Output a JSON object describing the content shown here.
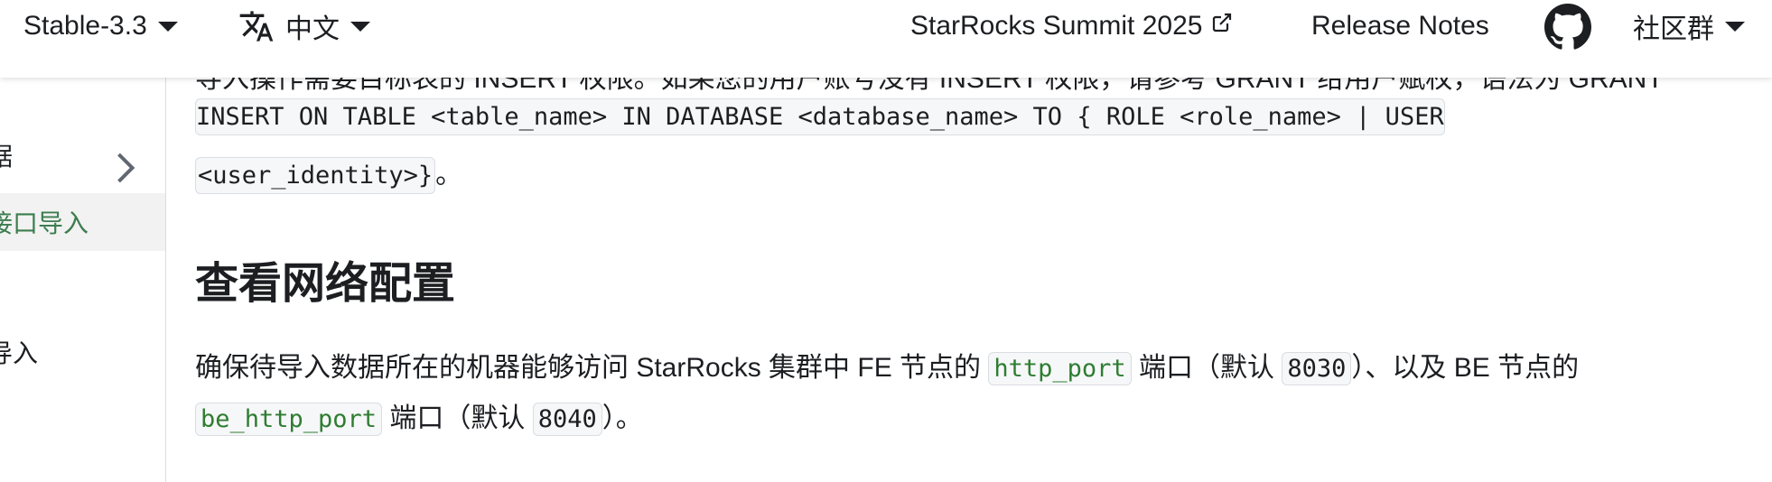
{
  "navbar": {
    "version_label": "Stable-3.3",
    "language_label": "中文",
    "summit_label": "StarRocks Summit 2025",
    "release_notes_label": "Release Notes",
    "community_label": "社区群"
  },
  "sidebar": {
    "items": [
      {
        "label": "据"
      },
      {
        "label": "接口导入"
      },
      {
        "label": "导入"
      }
    ]
  },
  "content": {
    "partial_top_text": "导入操作需要目标表的 INSERT 权限。如果您的用户账号没有 INSERT 权限，请参考 GRANT 给用户赋权，语法为 GRANT",
    "grant_code_line1": "INSERT ON TABLE <table_name> IN DATABASE <database_name> TO { ROLE <role_name> | USER",
    "grant_code_line2": "<user_identity>}",
    "grant_code_suffix": "。",
    "section_title": "查看网络配置",
    "para_part1": "确保待导入数据所在的机器能够访问 StarRocks 集群中 FE 节点的 ",
    "code_http_port": "http_port",
    "para_part2": " 端口（默认 ",
    "code_8030": "8030",
    "para_part3": "）、以及 BE 节点的",
    "code_be_http_port": "be_http_port",
    "para_part4": " 端口（默认 ",
    "code_8040": "8040",
    "para_part5": "）。"
  },
  "colors": {
    "accent_green": "#3c7d4f",
    "code_bg": "#f6f7f8",
    "border": "#dadde1"
  },
  "icons": [
    "chevron-down-icon",
    "translate-icon",
    "external-link-icon",
    "github-icon",
    "chevron-right-icon"
  ]
}
